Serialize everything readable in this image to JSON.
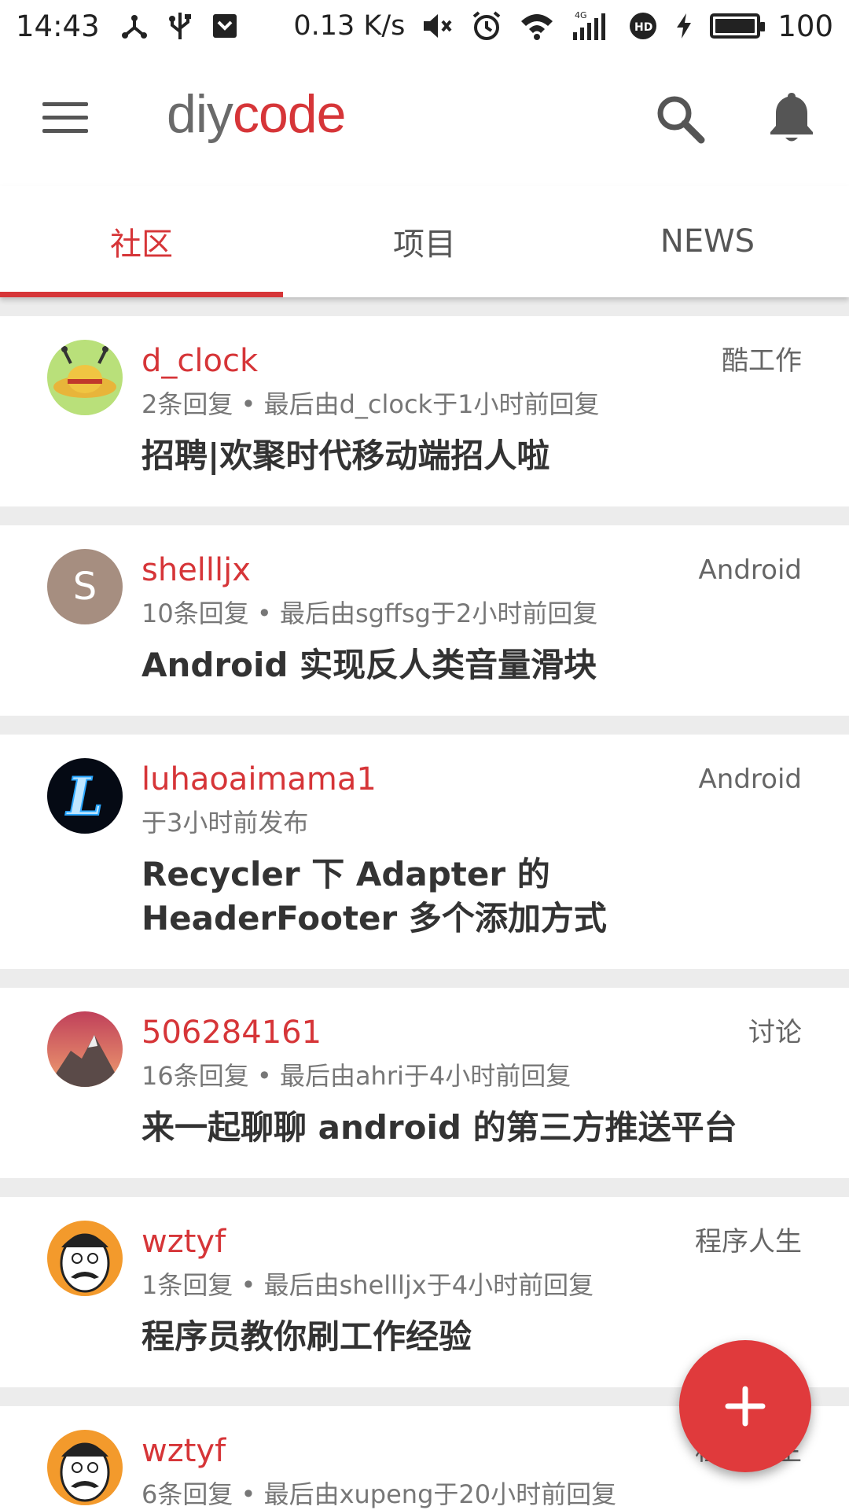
{
  "status_bar": {
    "time": "14:43",
    "net_speed": "0.13 K/s",
    "network": "4G",
    "battery": "100",
    "battery_level": 1.0
  },
  "app_bar": {
    "logo_part1": "diy",
    "logo_part2": "code",
    "icons": [
      "menu-icon",
      "search-icon",
      "bell-icon"
    ]
  },
  "tabs": [
    {
      "label": "社区",
      "active": true
    },
    {
      "label": "项目",
      "active": false
    },
    {
      "label": "NEWS",
      "active": false
    }
  ],
  "topics": [
    {
      "user": "d_clock",
      "node": "酷工作",
      "meta": "2条回复 • 最后由d_clock于1小时前回复",
      "title": "招聘|欢聚时代移动端招人啦",
      "avatar": "straw-hat-avatar"
    },
    {
      "user": "shellljx",
      "node": "Android",
      "meta": "10条回复 • 最后由sgffsg于2小时前回复",
      "title": "Android 实现反人类音量滑块",
      "avatar": "letter-s-avatar",
      "avatar_letter": "S"
    },
    {
      "user": "luhaoaimama1",
      "node": "Android",
      "meta": "于3小时前发布",
      "title": "Recycler 下 Adapter 的 HeaderFooter 多个添加方式",
      "avatar": "letter-l-avatar",
      "avatar_letter": "L"
    },
    {
      "user": "506284161",
      "node": "讨论",
      "meta": "16条回复 • 最后由ahri于4小时前回复",
      "title": "来一起聊聊 android 的第三方推送平台",
      "avatar": "mountain-avatar"
    },
    {
      "user": "wztyf",
      "node": "程序人生",
      "meta": "1条回复 • 最后由shellljx于4小时前回复",
      "title": "程序员教你刷工作经验",
      "avatar": "cartoon-face-avatar"
    },
    {
      "user": "wztyf",
      "node": "程序人生",
      "meta": "6条回复 • 最后由xupeng于20小时前回复",
      "title": "",
      "avatar": "cartoon-face-avatar"
    }
  ],
  "colors": {
    "accent": "#d63538",
    "fab": "#e03a3c",
    "background": "#ececec"
  },
  "fab": {
    "icon": "plus-icon"
  }
}
